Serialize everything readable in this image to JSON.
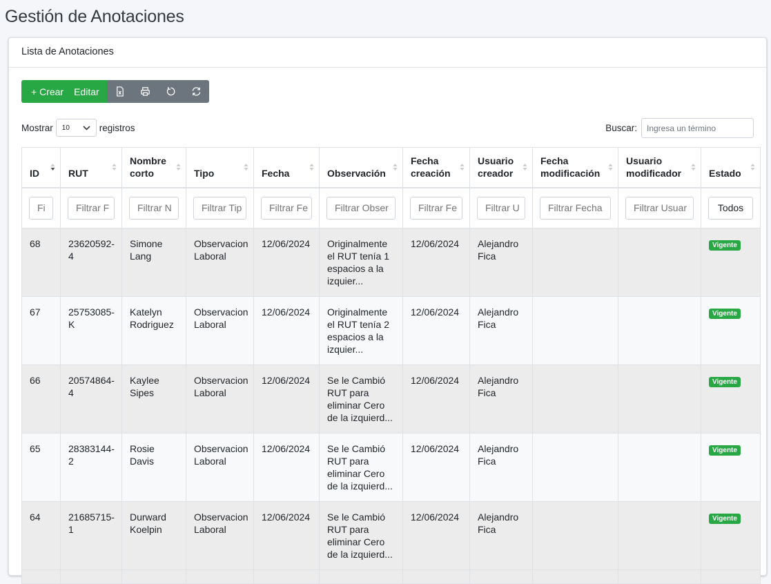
{
  "page": {
    "title": "Gestión de Anotaciones"
  },
  "card": {
    "header": "Lista de Anotaciones"
  },
  "toolbar": {
    "create_label": "+ Crear",
    "edit_label": "Editar",
    "icons": [
      "excel-icon",
      "print-icon",
      "reset-icon",
      "refresh-icon"
    ]
  },
  "length": {
    "prefix": "Mostrar",
    "value": "10",
    "suffix": "registros"
  },
  "search": {
    "label": "Buscar:",
    "placeholder": "Ingresa un término"
  },
  "columns": [
    {
      "l1": "ID",
      "l2": ""
    },
    {
      "l1": "RUT",
      "l2": ""
    },
    {
      "l1": "Nombre",
      "l2": "corto"
    },
    {
      "l1": "Tipo",
      "l2": ""
    },
    {
      "l1": "Fecha",
      "l2": ""
    },
    {
      "l1": "Observación",
      "l2": ""
    },
    {
      "l1": "Fecha",
      "l2": "creación"
    },
    {
      "l1": "Usuario",
      "l2": "creador"
    },
    {
      "l1": "Fecha",
      "l2": "modificación"
    },
    {
      "l1": "Usuario",
      "l2": "modificador"
    },
    {
      "l1": "Estado",
      "l2": ""
    }
  ],
  "filters": [
    "Fi",
    "Filtrar F",
    "Filtrar N",
    "Filtrar Tip",
    "Filtrar Fe",
    "Filtrar Obser",
    "Filtrar Fe",
    "Filtrar U",
    "Filtrar Fecha",
    "Filtrar Usuar",
    "Todos"
  ],
  "rows": [
    {
      "id": "68",
      "rut": "23620592-4",
      "nombre": "Simone Lang",
      "tipo": "Observacion Laboral",
      "fecha": "12/06/2024",
      "obs": "Originalmente el RUT tenía 1 espacios a la izquier...",
      "fcrea": "12/06/2024",
      "ucrea": "Alejandro Fica",
      "fmod": "",
      "umod": "",
      "estado": "Vigente"
    },
    {
      "id": "67",
      "rut": "25753085-K",
      "nombre": "Katelyn Rodriguez",
      "tipo": "Observacion Laboral",
      "fecha": "12/06/2024",
      "obs": "Originalmente el RUT tenía 2 espacios a la izquier...",
      "fcrea": "12/06/2024",
      "ucrea": "Alejandro Fica",
      "fmod": "",
      "umod": "",
      "estado": "Vigente"
    },
    {
      "id": "66",
      "rut": "20574864-4",
      "nombre": "Kaylee Sipes",
      "tipo": "Observacion Laboral",
      "fecha": "12/06/2024",
      "obs": "Se le Cambió RUT para eliminar Cero de la izquierd...",
      "fcrea": "12/06/2024",
      "ucrea": "Alejandro Fica",
      "fmod": "",
      "umod": "",
      "estado": "Vigente"
    },
    {
      "id": "65",
      "rut": "28383144-2",
      "nombre": "Rosie Davis",
      "tipo": "Observacion Laboral",
      "fecha": "12/06/2024",
      "obs": "Se le Cambió RUT para eliminar Cero de la izquierd...",
      "fcrea": "12/06/2024",
      "ucrea": "Alejandro Fica",
      "fmod": "",
      "umod": "",
      "estado": "Vigente"
    },
    {
      "id": "64",
      "rut": "21685715-1",
      "nombre": "Durward Koelpin",
      "tipo": "Observacion Laboral",
      "fecha": "12/06/2024",
      "obs": "Se le Cambió RUT para eliminar Cero de la izquierd...",
      "fcrea": "12/06/2024",
      "ucrea": "Alejandro Fica",
      "fmod": "",
      "umod": "",
      "estado": "Vigente"
    }
  ],
  "colors": {
    "green": "#28a745",
    "grey": "#6c757d"
  }
}
